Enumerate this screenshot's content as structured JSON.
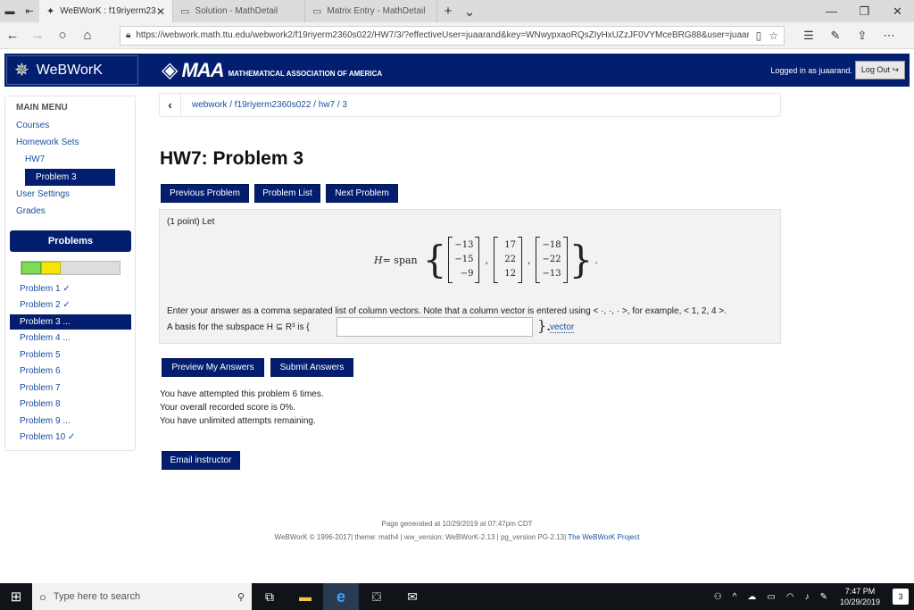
{
  "browser": {
    "tabs": [
      {
        "title": "WeBWorK : f19riyerm23",
        "active": true
      },
      {
        "title": "Solution - MathDetail",
        "active": false
      },
      {
        "title": "Matrix Entry - MathDetail",
        "active": false
      }
    ],
    "url": "https://webwork.math.ttu.edu/webwork2/f19riyerm2360s022/HW7/3/?effectiveUser=juaarand&key=WNwypxaoRQsZIyHxUZzJF0VYMceBRG88&user=juaarand"
  },
  "header": {
    "brand": "WeBWorK",
    "maa_big": "MAA",
    "maa_small": "MATHEMATICAL ASSOCIATION OF AMERICA",
    "logged_in": "Logged in as juaarand.",
    "logout": "Log Out"
  },
  "sidebar": {
    "title": "MAIN MENU",
    "links": {
      "courses": "Courses",
      "homework_sets": "Homework Sets",
      "hw7": "HW7",
      "problem3": "Problem 3",
      "user_settings": "User Settings",
      "grades": "Grades"
    },
    "problems_header": "Problems",
    "progress": {
      "correct_fraction": 0.2,
      "partial_fraction": 0.2
    },
    "problems": [
      "Problem 1 ✓",
      "Problem 2 ✓",
      "Problem 3 ...",
      "Problem 4 ...",
      "Problem 5",
      "Problem 6",
      "Problem 7",
      "Problem 8",
      "Problem 9 ...",
      "Problem 10 ✓"
    ]
  },
  "main": {
    "breadcrumb": "webwork / f19riyerm2360s022 / hw7 / 3",
    "title": "HW7: Problem 3",
    "buttons": {
      "previous": "Previous Problem",
      "list": "Problem List",
      "next": "Next Problem",
      "preview": "Preview My Answers",
      "submit": "Submit Answers",
      "email": "Email instructor"
    },
    "problem": {
      "intro": "(1 point) Let",
      "lhs": "H",
      "eq": " = span",
      "vectors": [
        [
          "−13",
          "−15",
          "−9"
        ],
        [
          "17",
          "22",
          "12"
        ],
        [
          "−18",
          "−22",
          "−13"
        ]
      ],
      "instructions": "Enter your answer as a comma separated list of column vectors. Note that a column vector is entered using < ·, ·, · >, for example, < 1, 2, 4 >.",
      "basis_label": "A basis for the subspace H ⊆ R³ is {",
      "answer_value": "",
      "brace_close": "}.",
      "vector_link": "vector"
    },
    "attempts": [
      "You have attempted this problem 6 times.",
      "Your overall recorded score is 0%.",
      "You have unlimited attempts remaining."
    ]
  },
  "footer": {
    "generated": "Page generated at 10/29/2019 at 07:47pm CDT",
    "meta": "WeBWorK © 1996-2017| theme: math4 | ww_version: WeBWorK-2.13 | pg_version PG-2.13|",
    "project": "The WeBWorK Project"
  },
  "taskbar": {
    "search_placeholder": "Type here to search",
    "time": "7:47 PM",
    "date": "10/29/2019",
    "notifications": "3"
  }
}
